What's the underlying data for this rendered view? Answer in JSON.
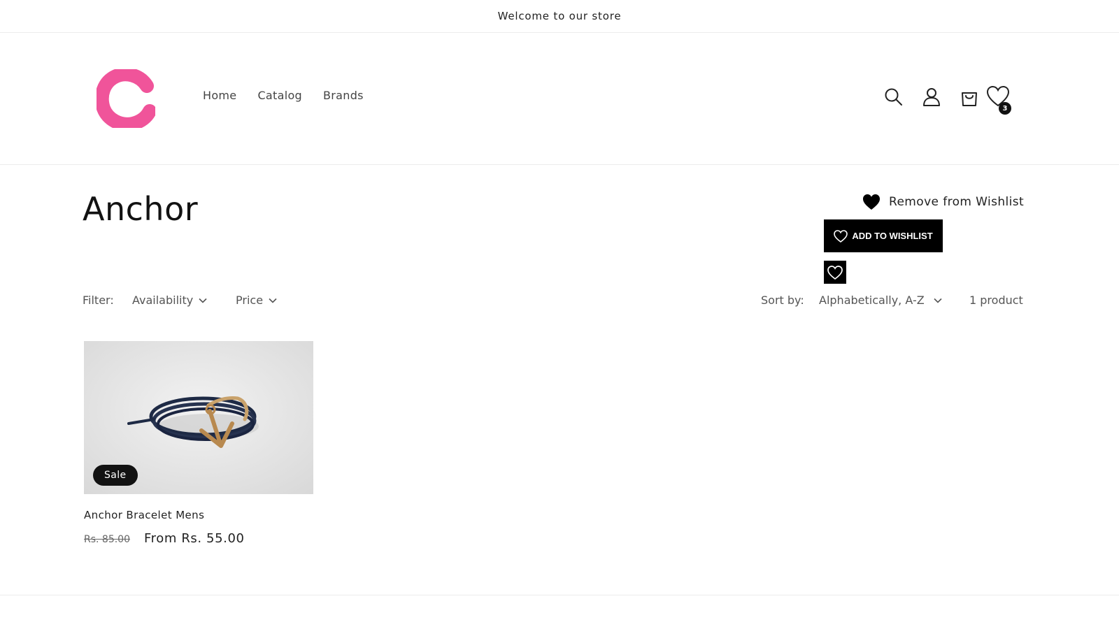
{
  "announcement": "Welcome to our store",
  "nav": {
    "home": "Home",
    "catalog": "Catalog",
    "brands": "Brands"
  },
  "header_icons": {
    "search": "search-icon",
    "account": "user-icon",
    "cart": "bag-icon",
    "wishlist": "heart-icon",
    "wishlist_count": "3"
  },
  "colors": {
    "brand_pink": "#f0549a",
    "text": "#121212",
    "muted": "#555555"
  },
  "collection": {
    "title": "Anchor"
  },
  "wishlist": {
    "remove_label": "Remove from Wishlist",
    "add_label": "ADD TO WISHLIST"
  },
  "filters": {
    "label": "Filter:",
    "availability": "Availability",
    "price": "Price"
  },
  "sort": {
    "label": "Sort by:",
    "selected": "Alphabetically, A-Z"
  },
  "product_count": "1 product",
  "products": [
    {
      "badge": "Sale",
      "name": "Anchor Bracelet Mens",
      "price_old": "Rs. 85.00",
      "price_new": "From Rs. 55.00"
    }
  ]
}
